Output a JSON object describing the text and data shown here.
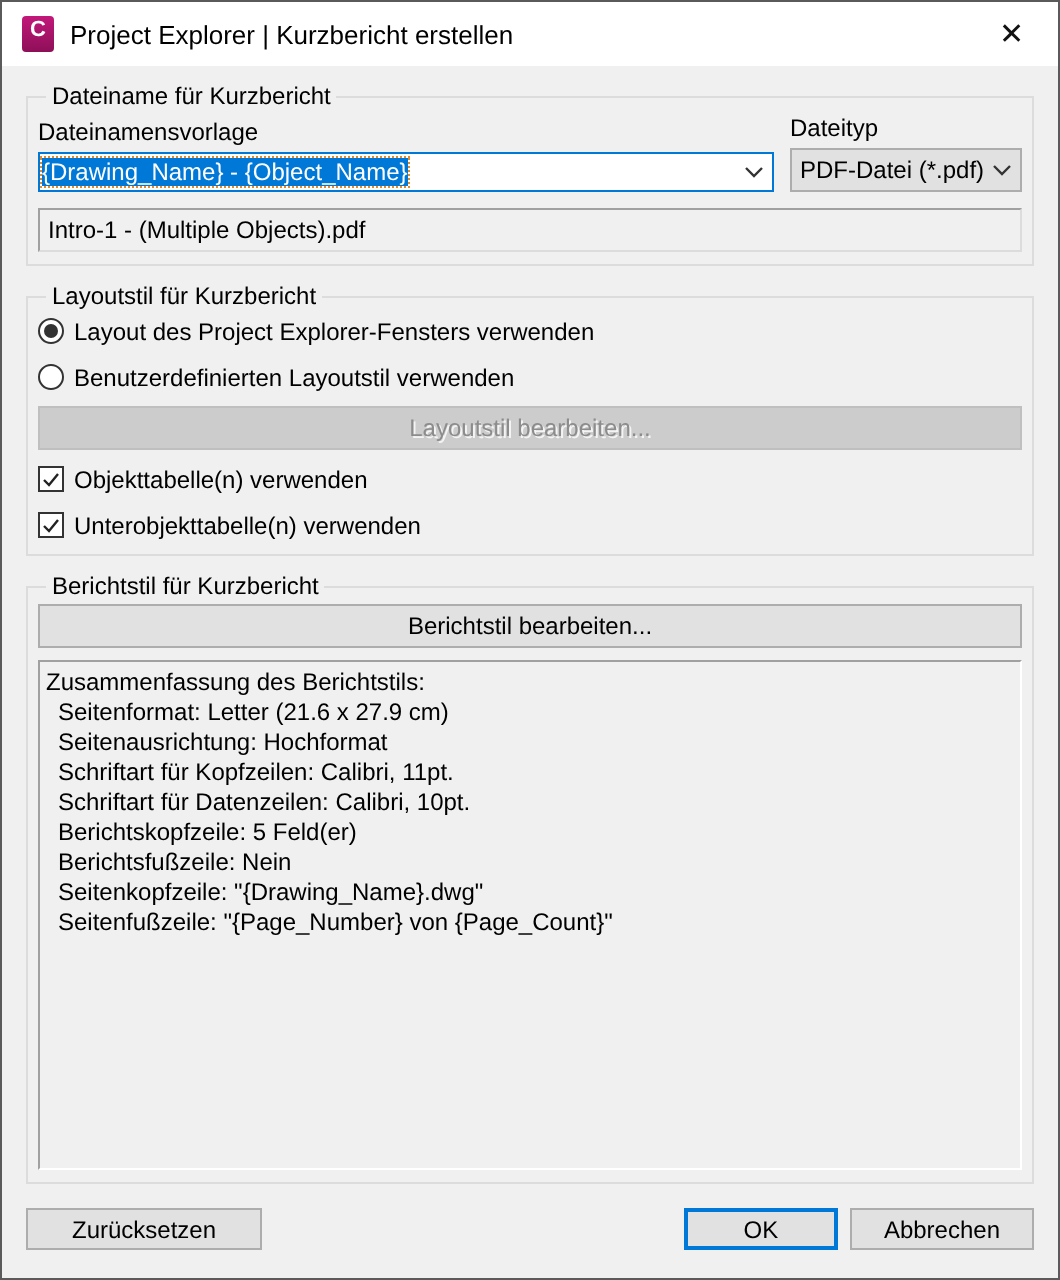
{
  "window": {
    "logo_letter": "C",
    "title": "Project Explorer | Kurzbericht erstellen",
    "close": "✕"
  },
  "filename_group": {
    "title": "Dateiname für Kurzbericht",
    "template_label": "Dateinamensvorlage",
    "template_value": "{Drawing_Name} - {Object_Name}",
    "template_selected": true,
    "filetype_label": "Dateityp",
    "filetype_value": "PDF-Datei (*.pdf)",
    "preview": "Intro-1 - (Multiple Objects).pdf"
  },
  "layout_group": {
    "title": "Layoutstil für Kurzbericht",
    "radios": [
      {
        "label": "Layout des Project Explorer-Fensters verwenden",
        "selected": true
      },
      {
        "label": "Benutzerdefinierten Layoutstil verwenden",
        "selected": false
      }
    ],
    "edit_button": {
      "label": "Layoutstil bearbeiten...",
      "disabled": true
    },
    "checkboxes": [
      {
        "label": "Objekttabelle(n) verwenden",
        "checked": true
      },
      {
        "label": "Unterobjekttabelle(n) verwenden",
        "checked": true
      }
    ]
  },
  "report_group": {
    "title": "Berichtstil für Kurzbericht",
    "edit_button": {
      "label": "Berichtstil bearbeiten...",
      "disabled": false
    },
    "summary": {
      "heading": "Zusammenfassung des Berichtstils:",
      "lines": [
        "Seitenformat: Letter (21.6 x 27.9 cm)",
        "Seitenausrichtung: Hochformat",
        "Schriftart für Kopfzeilen: Calibri, 11pt.",
        "Schriftart für Datenzeilen: Calibri, 10pt.",
        "Berichtskopfzeile: 5 Feld(er)",
        "Berichtsfußzeile: Nein",
        "Seitenkopfzeile: \"{Drawing_Name}.dwg\"",
        "Seitenfußzeile: \"{Page_Number} von {Page_Count}\""
      ]
    }
  },
  "reset_button": {
    "label": "Zurücksetzen",
    "default": false
  },
  "buttons": [
    {
      "label": "OK",
      "default": true
    },
    {
      "label": "Abbrechen",
      "default": false
    }
  ]
}
